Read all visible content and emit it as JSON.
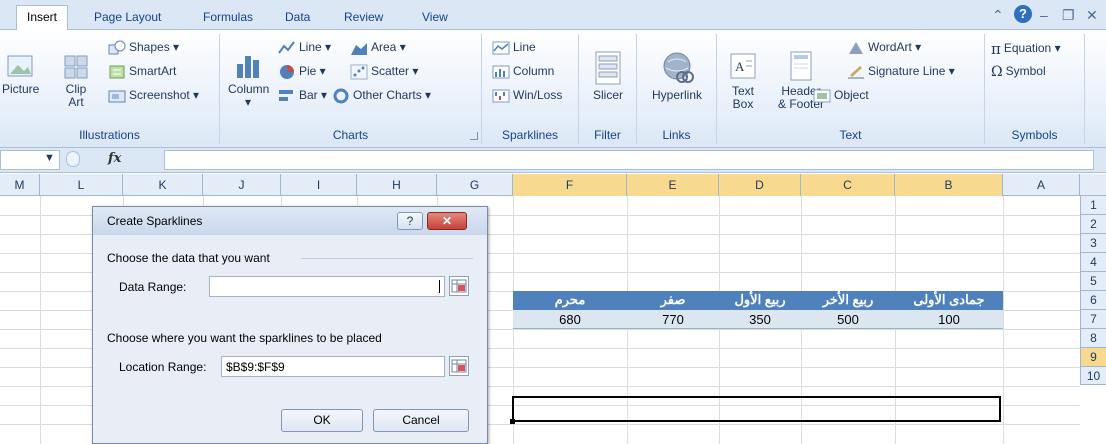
{
  "ribbon_tabs": [
    "Insert",
    "Page Layout",
    "Formulas",
    "Data",
    "Review",
    "View"
  ],
  "active_tab": "Insert",
  "groups": {
    "illustrations": {
      "label": "Illustrations",
      "picture": "Picture",
      "clip_art_1": "Clip",
      "clip_art_2": "Art",
      "shapes": "Shapes",
      "smartart": "SmartArt",
      "screenshot": "Screenshot"
    },
    "charts": {
      "label": "Charts",
      "column": "Column",
      "line": "Line",
      "area": "Area",
      "pie": "Pie",
      "scatter": "Scatter",
      "bar": "Bar",
      "other": "Other Charts"
    },
    "sparklines": {
      "label": "Sparklines",
      "line": "Line",
      "column": "Column",
      "winloss": "Win/Loss"
    },
    "filter": {
      "label": "Filter",
      "slicer": "Slicer"
    },
    "links": {
      "label": "Links",
      "hyperlink": "Hyperlink"
    },
    "text": {
      "label": "Text",
      "textbox_1": "Text",
      "textbox_2": "Box",
      "header_1": "Header",
      "header_2": "& Footer",
      "wordart": "WordArt",
      "signature": "Signature Line",
      "object": "Object"
    },
    "symbols": {
      "label": "Symbols",
      "equation": "Equation",
      "symbol": "Symbol"
    }
  },
  "formula_bar": {
    "fx": "fx",
    "name_box": "",
    "value": ""
  },
  "columns": [
    "M",
    "L",
    "K",
    "J",
    "I",
    "H",
    "G",
    "F",
    "E",
    "D",
    "C",
    "B",
    "A"
  ],
  "rows": [
    "1",
    "2",
    "3",
    "4",
    "5",
    "6",
    "7",
    "8",
    "9",
    "10"
  ],
  "table": {
    "headers": [
      "محرم",
      "صفر",
      "ربيع الأول",
      "ربيع الأخر",
      "جمادى الأولى"
    ],
    "values": [
      "680",
      "770",
      "350",
      "500",
      "100"
    ]
  },
  "dialog": {
    "title": "Create Sparklines",
    "help": "?",
    "section1": "Choose the data that you want",
    "data_range_label": "Data Range:",
    "data_range_value": "",
    "section2": "Choose where you want the sparklines to be placed",
    "location_label": "Location Range:",
    "location_value": "$B$9:$F$9",
    "ok": "OK",
    "cancel": "Cancel"
  },
  "colors": {
    "header_fill": "#4f81bd",
    "value_fill": "#dce6f1",
    "selected_heading": "#f8d990",
    "close_button": "#c9403a"
  }
}
